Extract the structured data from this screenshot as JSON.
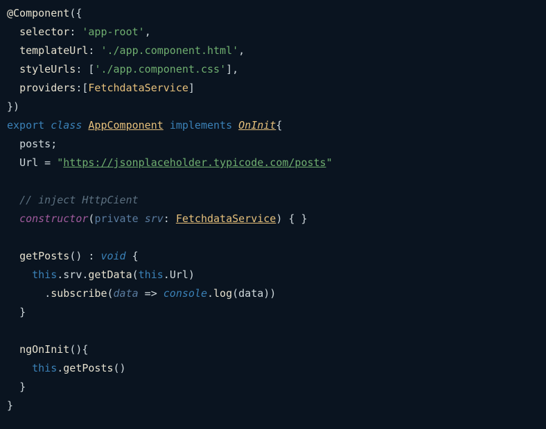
{
  "code": {
    "l1": {
      "at": "@",
      "comp": "Component",
      "open": "({"
    },
    "l2": {
      "key": "selector",
      "colon": ": ",
      "q1": "'",
      "val": "app-root",
      "q2": "'",
      "comma": ","
    },
    "l3": {
      "key": "templateUrl",
      "colon": ": ",
      "q1": "'",
      "val": "./app.component.html",
      "q2": "'",
      "comma": ","
    },
    "l4": {
      "key": "styleUrls",
      "colon": ": [",
      "q1": "'",
      "val": "./app.component.css",
      "q2": "'",
      "close": "],"
    },
    "l5": {
      "key": "providers",
      "colon": ":[",
      "svc": "FetchdataService",
      "close": "]"
    },
    "l6": {
      "close": "})"
    },
    "l7": {
      "export": "export",
      "sp1": " ",
      "class": "class",
      "sp2": " ",
      "name": "AppComponent",
      "sp3": " ",
      "impl": "implements",
      "sp4": " ",
      "oninit": "OnInit",
      "brace": "{"
    },
    "l8": {
      "ident": "posts",
      "semi": ";"
    },
    "l9": {
      "ident": "Url",
      "eq": " = ",
      "q1": "\"",
      "url": "https://jsonplaceholder.typicode.com/posts",
      "q2": "\""
    },
    "l10": "",
    "l11": {
      "text": "// inject HttpCient"
    },
    "l12": {
      "ctor": "constructor",
      "open": "(",
      "priv": "private",
      "sp": " ",
      "param": "srv",
      "colon": ": ",
      "type": "FetchdataService",
      "close": ") { }"
    },
    "l13": "",
    "l14": {
      "name": "getPosts",
      "parens": "() : ",
      "void": "void",
      "brace": " {"
    },
    "l15": {
      "this": "this",
      "dot1": ".",
      "srv": "srv",
      "dot2": ".",
      "method": "getData",
      "open": "(",
      "this2": "this",
      "dot3": ".",
      "url": "Url",
      "close": ")"
    },
    "l16": {
      "dot": ".",
      "sub": "subscribe",
      "open": "(",
      "data": "data",
      "arrow": " => ",
      "console": "console",
      "dot2": ".",
      "log": "log",
      "open2": "(",
      "data2": "data",
      "close": "))"
    },
    "l17": {
      "brace": "}"
    },
    "l18": "",
    "l19": {
      "name": "ngOnInit",
      "parens": "(){"
    },
    "l20": {
      "this": "this",
      "dot": ".",
      "method": "getPosts",
      "parens": "()"
    },
    "l21": {
      "brace": "}"
    },
    "l22": {
      "brace": "}"
    }
  }
}
